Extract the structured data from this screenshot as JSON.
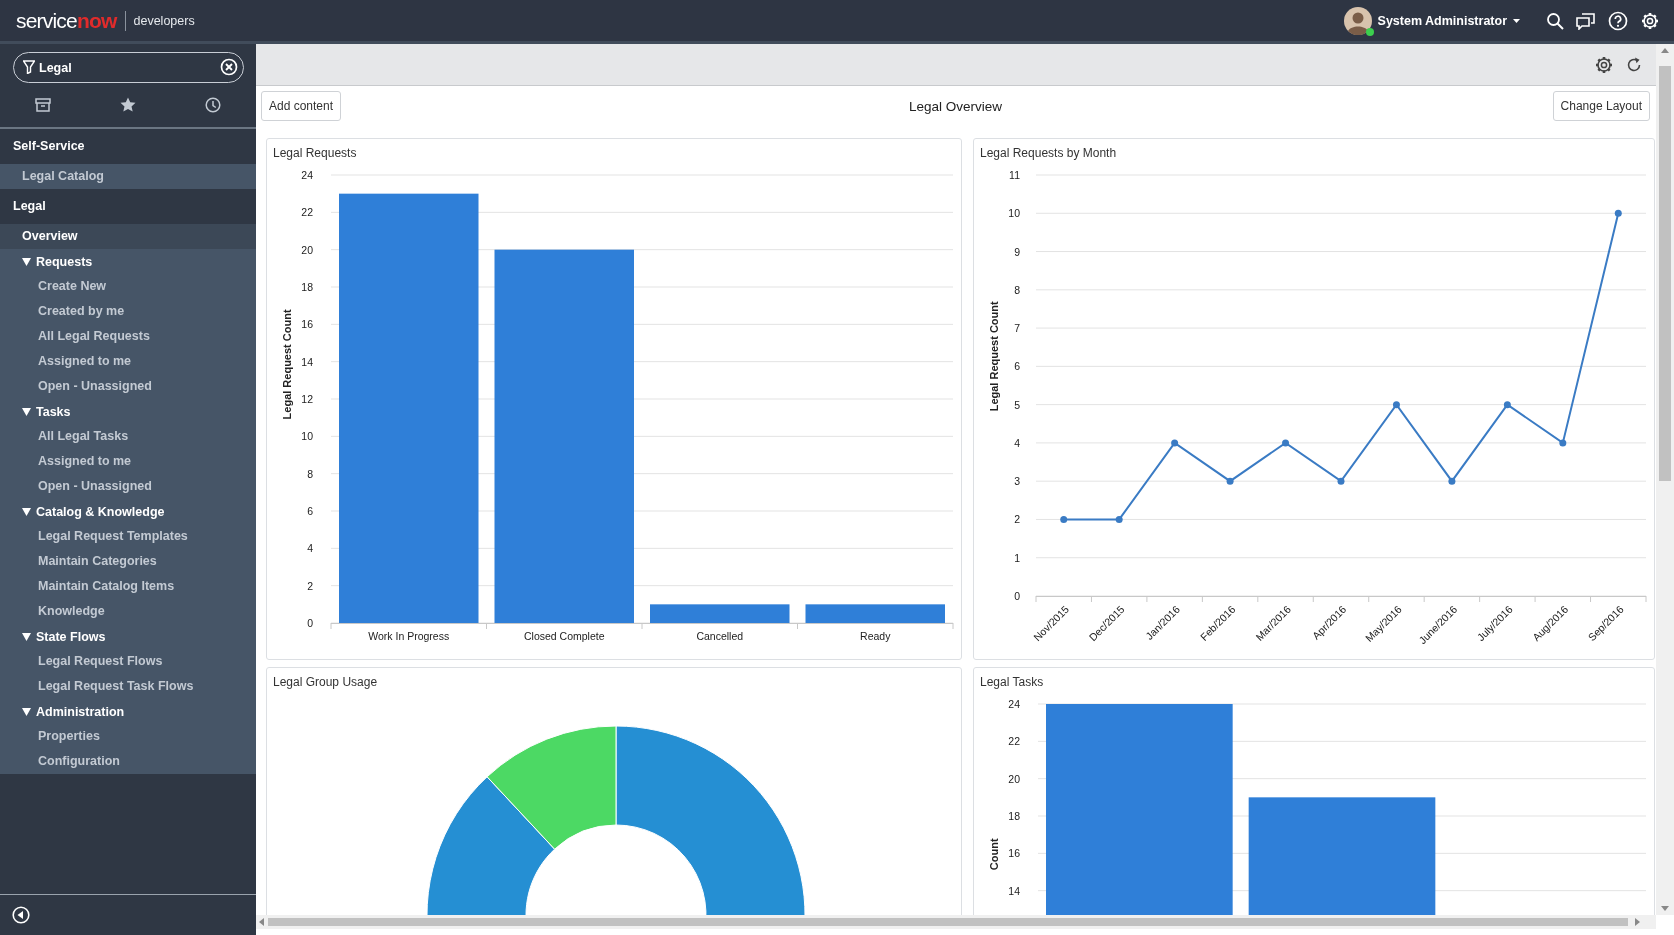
{
  "header": {
    "logo": [
      "service",
      "now"
    ],
    "product": "developers",
    "user": {
      "name": "System Administrator",
      "online": true
    }
  },
  "sidebar": {
    "filter": {
      "value": "Legal"
    },
    "sections": [
      {
        "title": "Self-Service",
        "items": [
          {
            "label": "Legal Catalog",
            "selected": false
          }
        ]
      },
      {
        "title": "Legal",
        "items": [
          {
            "label": "Overview",
            "selected": true
          },
          {
            "label": "Requests",
            "expanded": true,
            "selected": false,
            "children": [
              {
                "label": "Create New",
                "selected": false
              },
              {
                "label": "Created by me",
                "selected": false
              },
              {
                "label": "All Legal Requests",
                "selected": false
              },
              {
                "label": "Assigned to me",
                "selected": false
              },
              {
                "label": "Open - Unassigned",
                "selected": false
              }
            ]
          },
          {
            "label": "Tasks",
            "expanded": true,
            "selected": false,
            "children": [
              {
                "label": "All Legal Tasks",
                "selected": false
              },
              {
                "label": "Assigned to me",
                "selected": false
              },
              {
                "label": "Open - Unassigned",
                "selected": false
              }
            ]
          },
          {
            "label": "Catalog & Knowledge",
            "expanded": true,
            "selected": false,
            "children": [
              {
                "label": "Legal Request Templates",
                "selected": false
              },
              {
                "label": "Maintain Categories",
                "selected": false
              },
              {
                "label": "Maintain Catalog Items",
                "selected": false
              },
              {
                "label": "Knowledge",
                "selected": false
              }
            ]
          },
          {
            "label": "State Flows",
            "expanded": true,
            "selected": false,
            "children": [
              {
                "label": "Legal Request Flows",
                "selected": false
              },
              {
                "label": "Legal Request Task Flows",
                "selected": false
              }
            ]
          },
          {
            "label": "Administration",
            "expanded": true,
            "selected": false,
            "children": [
              {
                "label": "Properties",
                "selected": false
              },
              {
                "label": "Configuration",
                "selected": false
              }
            ]
          }
        ]
      }
    ]
  },
  "dashboard": {
    "add_button": "Add content",
    "title": "Legal Overview",
    "layout_button": "Change Layout",
    "widgets": [
      {
        "title": "Legal Requests",
        "kind": "bar",
        "chart_data": {
          "type": "bar",
          "ylabel": "Legal Request Count",
          "categories": [
            "Work In Progress",
            "Closed Complete",
            "Cancelled",
            "Ready"
          ],
          "values": [
            23,
            20,
            1,
            1
          ],
          "grid": true,
          "ylim": [
            0,
            24
          ],
          "yticks": [
            0,
            2,
            4,
            6,
            8,
            10,
            12,
            14,
            16,
            18,
            20,
            22,
            24
          ]
        }
      },
      {
        "title": "Legal Requests by Month",
        "kind": "line",
        "chart_data": {
          "type": "line",
          "ylabel": "Legal Request Count",
          "categories": [
            "Nov/2015",
            "Dec/2015",
            "Jan/2016",
            "Feb/2016",
            "Mar/2016",
            "Apr/2016",
            "May/2016",
            "June/2016",
            "July/2016",
            "Aug/2016",
            "Sep/2016"
          ],
          "values": [
            2,
            2,
            4,
            3,
            4,
            3,
            5,
            3,
            5,
            4,
            10
          ],
          "grid": true,
          "marker": true,
          "ylim": [
            0,
            11
          ],
          "yticks": [
            0,
            1,
            2,
            3,
            4,
            5,
            6,
            7,
            8,
            9,
            10,
            11
          ]
        }
      },
      {
        "title": "Legal Group Usage",
        "kind": "donut"
      },
      {
        "title": "Legal Tasks",
        "kind": "bar",
        "chart_data": {
          "type": "bar",
          "ylabel": "Count",
          "values": [
            24,
            19
          ],
          "grid": true,
          "ylim": [
            0,
            24
          ],
          "yticks": [
            14,
            16,
            18,
            20,
            22,
            24
          ]
        }
      }
    ]
  }
}
